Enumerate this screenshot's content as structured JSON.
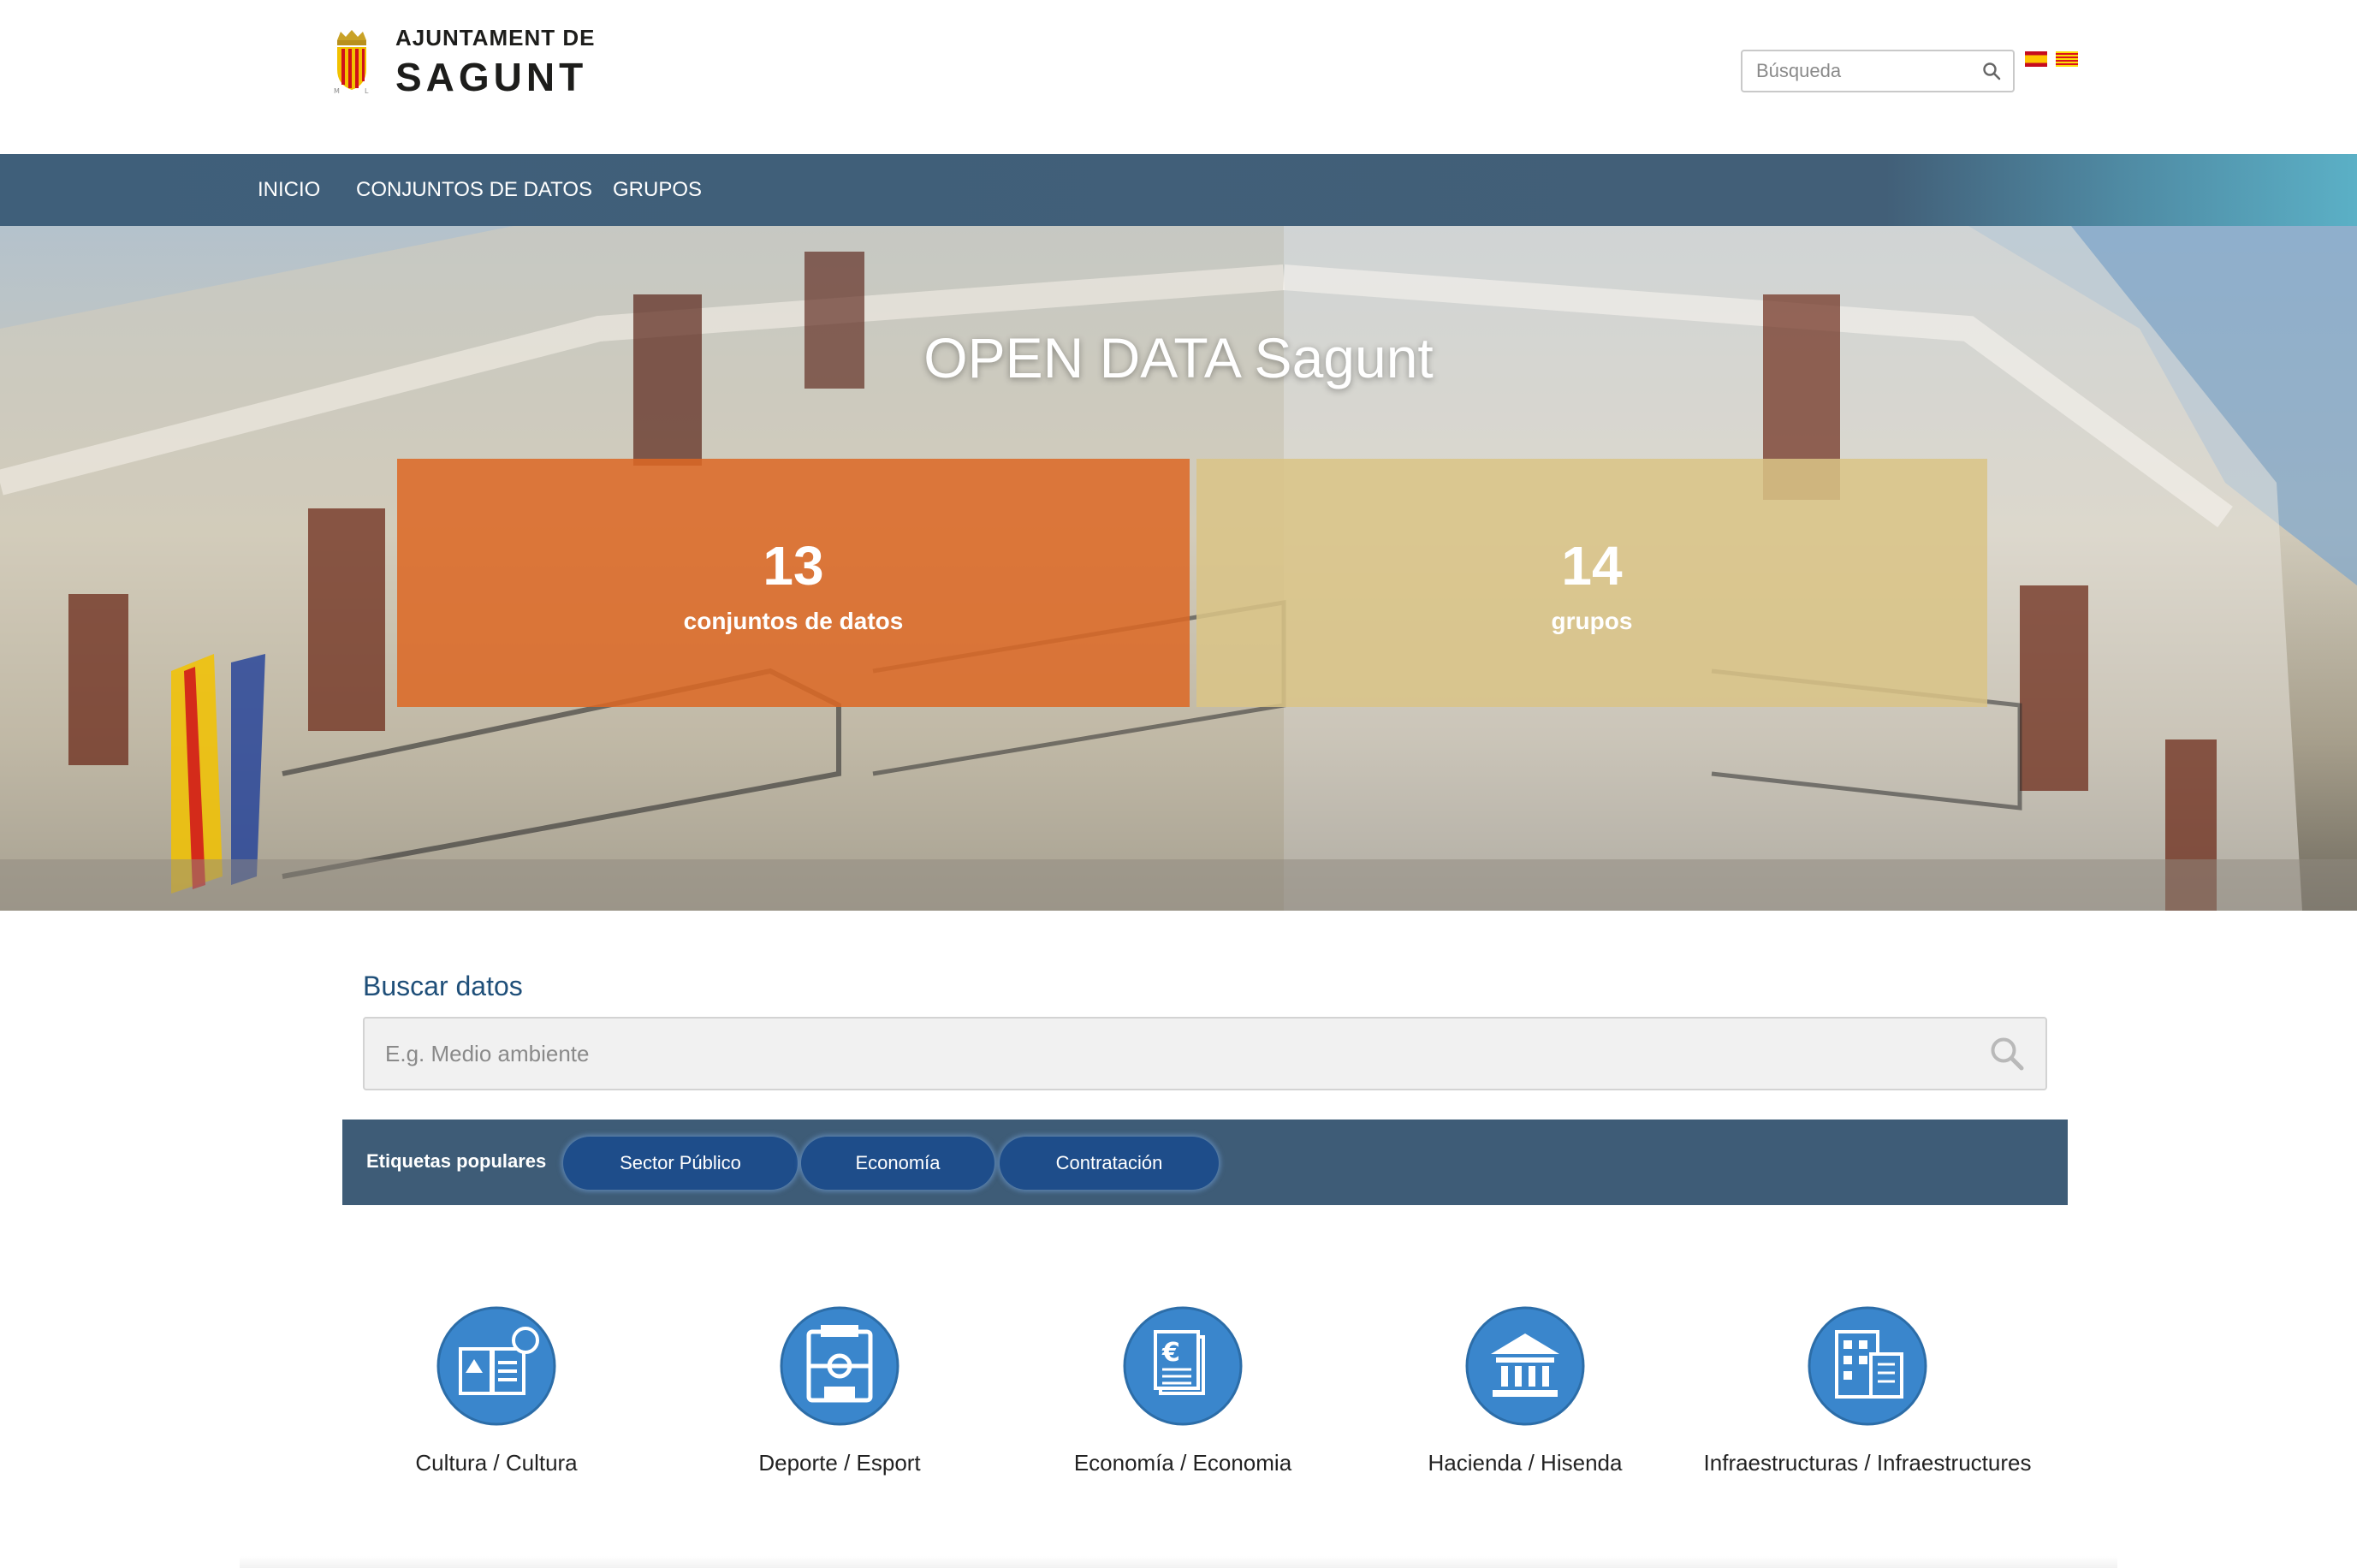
{
  "header": {
    "logo_top": "AJUNTAMENT DE",
    "logo_main": "SAGUNT",
    "search_placeholder": "Búsqueda",
    "languages": [
      "es-flag-icon",
      "ca-flag-icon"
    ]
  },
  "nav": {
    "items": [
      {
        "label": "INICIO"
      },
      {
        "label": "CONJUNTOS DE DATOS"
      },
      {
        "label": "GRUPOS"
      }
    ]
  },
  "hero": {
    "title": "OPEN DATA Sagunt",
    "stats": [
      {
        "value": "13",
        "label": "conjuntos de datos",
        "color": "#dc6824"
      },
      {
        "value": "14",
        "label": "grupos",
        "color": "#dac486"
      }
    ]
  },
  "search": {
    "title": "Buscar datos",
    "placeholder": "E.g. Medio ambiente"
  },
  "tags": {
    "label": "Etiquetas populares",
    "items": [
      {
        "label": "Sector Público"
      },
      {
        "label": "Economía"
      },
      {
        "label": "Contratación"
      }
    ]
  },
  "categories": [
    {
      "label": "Cultura / Cultura",
      "icon": "culture-icon"
    },
    {
      "label": "Deporte / Esport",
      "icon": "sport-icon"
    },
    {
      "label": "Economía / Economia",
      "icon": "economy-icon"
    },
    {
      "label": "Hacienda / Hisenda",
      "icon": "treasury-icon"
    },
    {
      "label": "Infraestructuras / Infraestructures",
      "icon": "infrastructure-icon"
    }
  ],
  "colors": {
    "nav": "#425f78",
    "accent_blue": "#3a86cc",
    "tag_pill": "#1e4d8a",
    "title_blue": "#1f4f79"
  }
}
